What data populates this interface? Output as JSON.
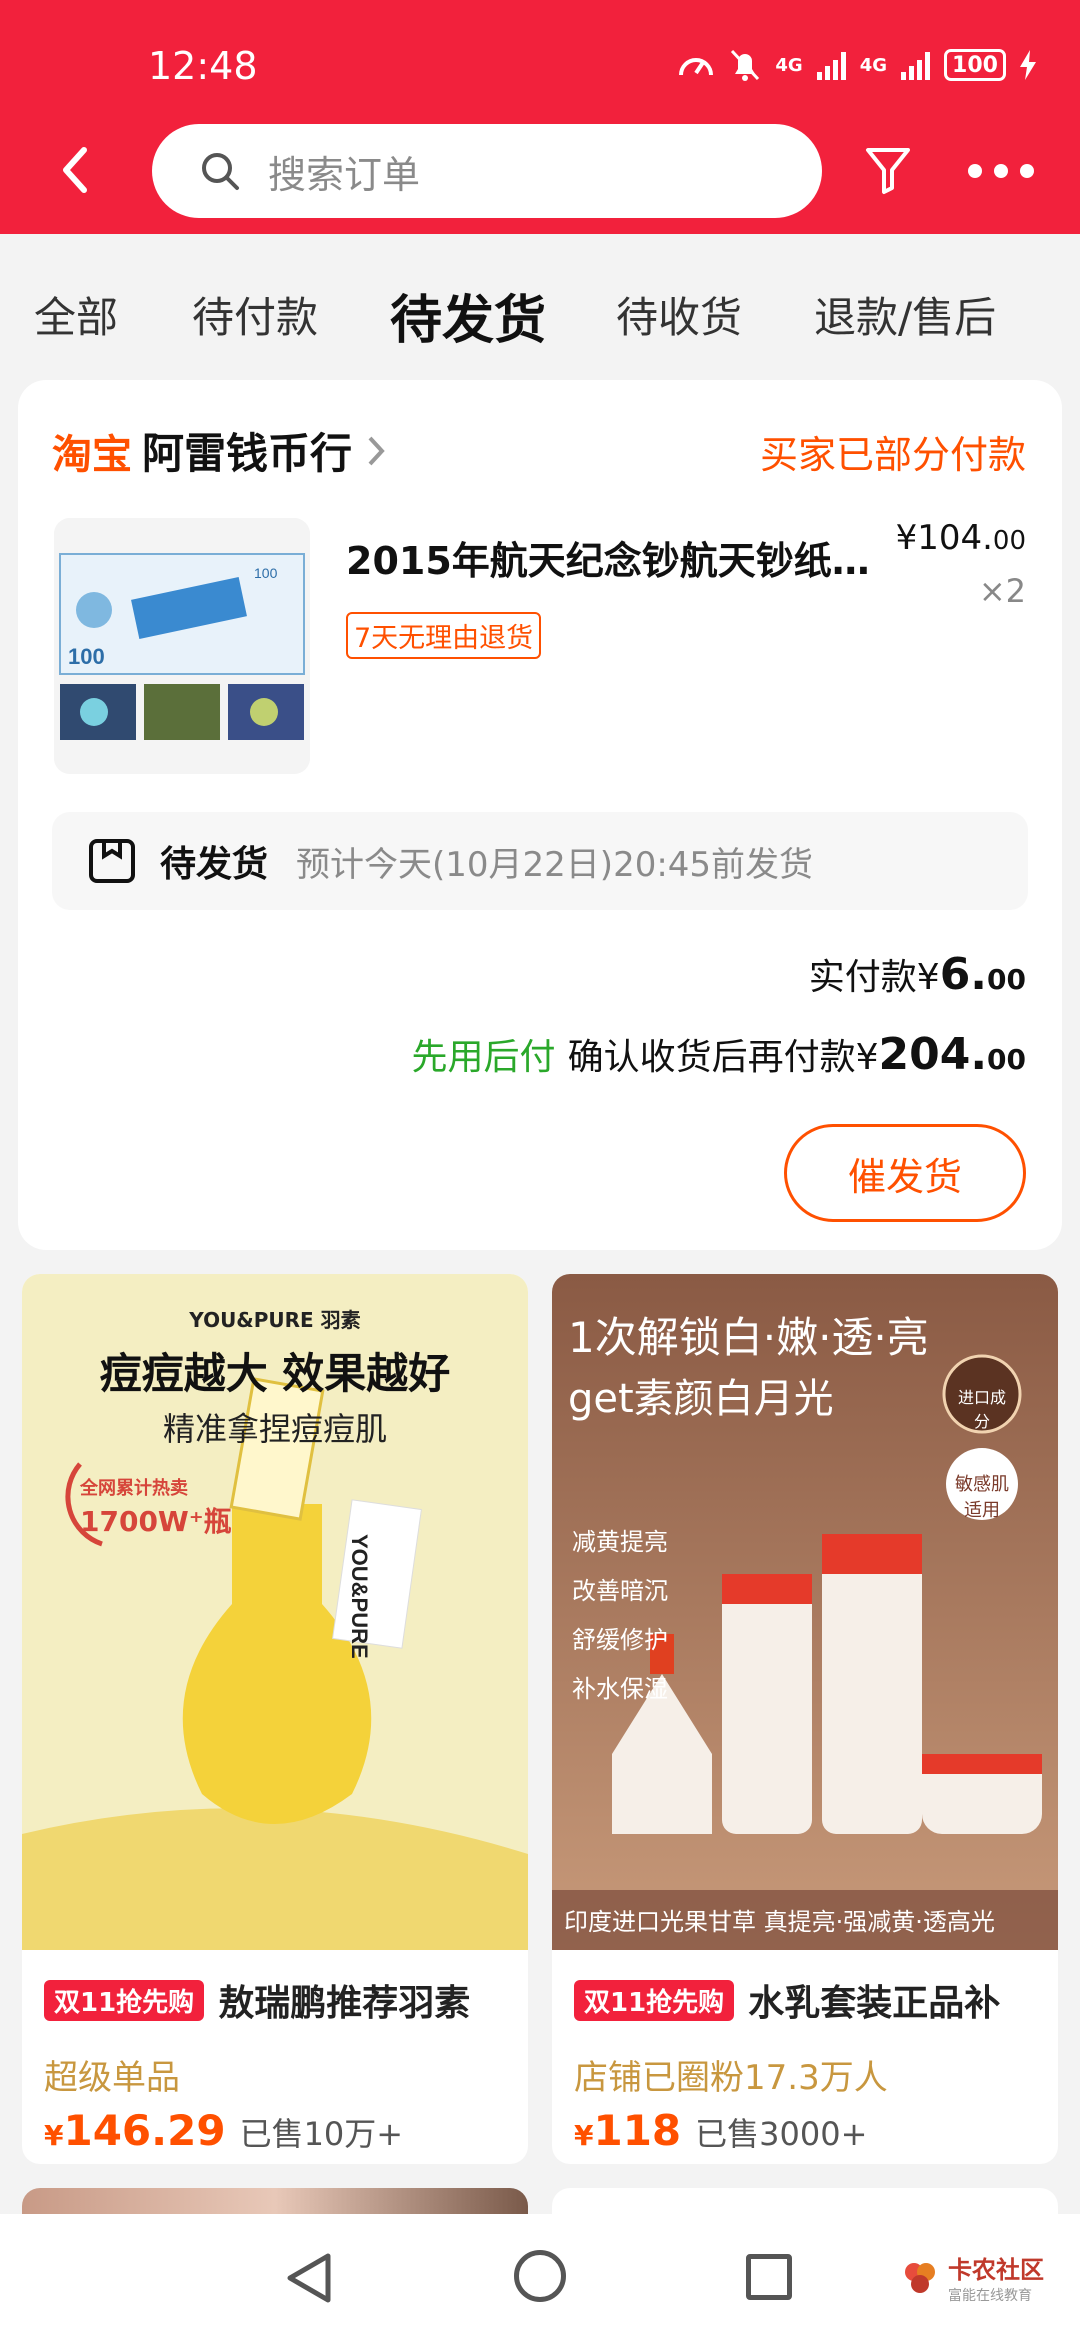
{
  "status_bar": {
    "time": "12:48",
    "battery": "100",
    "net1": "4G",
    "net2": "4G"
  },
  "header": {
    "search_placeholder": "搜索订单"
  },
  "tabs": [
    "全部",
    "待付款",
    "待发货",
    "待收货",
    "退款/售后"
  ],
  "tab_active_index": 2,
  "order": {
    "platform": "淘宝",
    "shop_name": "阿雷钱币行",
    "status": "买家已部分付款",
    "product_title": "2015年航天纪念钞航天钞纸…",
    "price_int": "¥104.",
    "price_dec": "00",
    "qty": "×2",
    "return_policy": "7天无理由退货",
    "ship_status": "待发货",
    "ship_estimate": "预计今天(10月22日)20:45前发货",
    "paid_label": "实付款¥",
    "paid_int": "6.",
    "paid_dec": "00",
    "later_label": "先用后付",
    "later_text": "确认收货后再付款¥",
    "later_int": "204.",
    "later_dec": "00",
    "urge_button": "催发货"
  },
  "recommendations": [
    {
      "tag": "双11抢先购",
      "name": "敖瑞鹏推荐羽素",
      "sub": "超级单品",
      "yen": "¥",
      "price": "146.29",
      "sold": "已售10万+",
      "img_brand": "YOU&PURE 羽素",
      "img_headline": "痘痘越大 效果越好",
      "img_sub": "精准拿捏痘痘肌",
      "img_badge_1": "全网累计热卖",
      "img_badge_2": "1700W⁺瓶"
    },
    {
      "tag": "双11抢先购",
      "name": "水乳套装正品补",
      "sub": "店铺已圈粉17.3万人",
      "yen": "¥",
      "price": "118",
      "sold": "已售3000+",
      "img_headline": "1次解锁白·嫩·透·亮",
      "img_sub": "get素颜白月光",
      "img_badge": "进口成分",
      "img_badge_2": "敏感肌适用",
      "img_benefits": [
        "减黄提亮",
        "改善暗沉",
        "舒缓修护",
        "补水保湿"
      ],
      "img_footer": "印度进口光果甘草  真提亮·强减黄·透高光"
    }
  ],
  "watermark": {
    "title": "卡农社区",
    "sub": "富能在线教育"
  },
  "colors": {
    "brand_red": "#f2213c",
    "orange": "#ff5000",
    "green": "#2aa82a"
  }
}
